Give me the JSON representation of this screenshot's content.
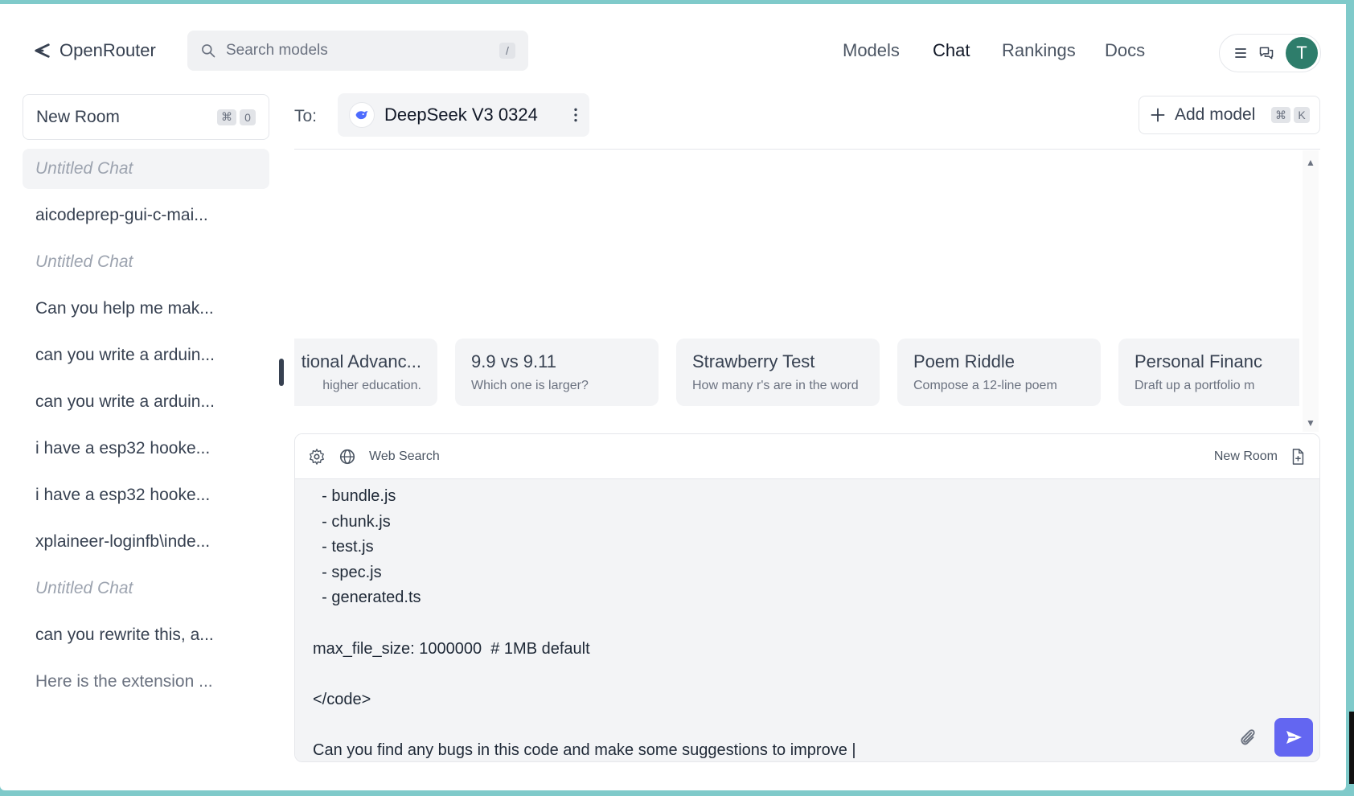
{
  "header": {
    "brand": "OpenRouter",
    "search_placeholder": "Search models",
    "search_shortcut": "/",
    "nav": [
      "Models",
      "Chat",
      "Rankings",
      "Docs"
    ],
    "active_nav": "Chat",
    "avatar_initial": "T"
  },
  "sidebar": {
    "new_room_label": "New Room",
    "new_room_keys": [
      "⌘",
      "0"
    ],
    "chats": [
      {
        "label": "Untitled Chat",
        "untitled": true,
        "selected": true
      },
      {
        "label": "aicodeprep-gui-c-mai..."
      },
      {
        "label": "Untitled Chat",
        "untitled": true
      },
      {
        "label": "Can you help me mak..."
      },
      {
        "label": "can you write a arduin..."
      },
      {
        "label": "can you write a arduin..."
      },
      {
        "label": "i have a esp32 hooke..."
      },
      {
        "label": "i have a esp32 hooke..."
      },
      {
        "label": "xplaineer-loginfb\\inde..."
      },
      {
        "label": "Untitled Chat",
        "untitled": true
      },
      {
        "label": "can you rewrite this, a..."
      },
      {
        "label": "Here is the extension ...",
        "faded": true
      }
    ]
  },
  "main": {
    "to_label": "To:",
    "model_name": "DeepSeek V3 0324",
    "add_model_label": "Add model",
    "add_model_keys": [
      "⌘",
      "K"
    ],
    "suggestions": [
      {
        "title": "tional Advanc...",
        "sub": "higher education."
      },
      {
        "title": "9.9 vs 9.11",
        "sub": "Which one is larger?"
      },
      {
        "title": "Strawberry Test",
        "sub": "How many r's are in the word"
      },
      {
        "title": "Poem Riddle",
        "sub": "Compose a 12-line poem"
      },
      {
        "title": "Personal Financ",
        "sub": "Draft up a portfolio m"
      }
    ]
  },
  "composer": {
    "web_search_label": "Web Search",
    "new_room_label": "New Room",
    "lines": [
      "  - bundle.js",
      "  - chunk.js",
      "  - test.js",
      "  - spec.js",
      "  - generated.ts",
      "",
      "max_file_size: 1000000  # 1MB default",
      "",
      "</code>",
      "",
      "Can you find any bugs in this code and make some suggestions to improve |"
    ]
  },
  "colors": {
    "accent": "#6366f1",
    "avatar": "#2e7d6b",
    "background_frame": "#7fcaca"
  }
}
